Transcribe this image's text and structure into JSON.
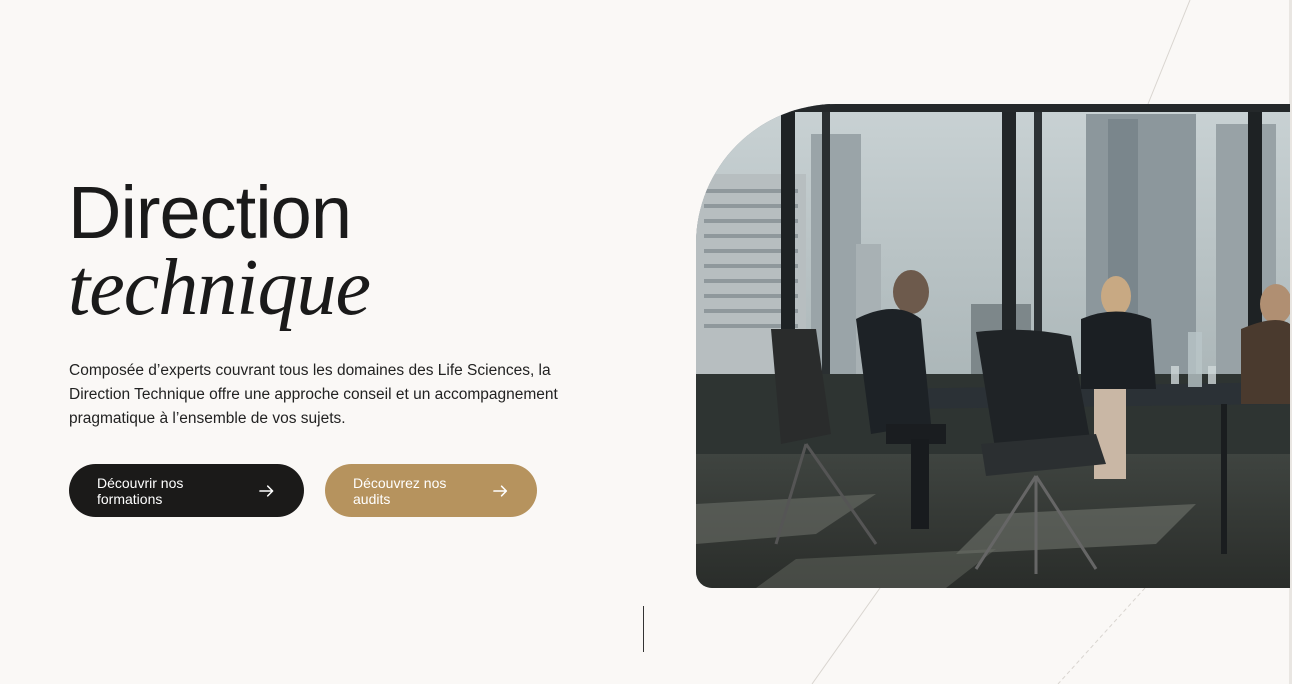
{
  "hero": {
    "title_line1": "Direction",
    "title_line2": "technique",
    "description": "Composée d’experts couvrant tous les domaines des Life Sciences, la Direction Technique offre une approche conseil et un accompagnement pragmatique à l’ensemble de vos sujets."
  },
  "buttons": {
    "formations_label": "Découvrir nos formations",
    "audits_label": "Découvrez nos audits"
  },
  "colors": {
    "background": "#faf8f6",
    "dark_button": "#1b1a19",
    "gold_button": "#b6935e",
    "text": "#1c1c1c"
  },
  "icons": {
    "button_arrow": "arrow-right-icon"
  }
}
